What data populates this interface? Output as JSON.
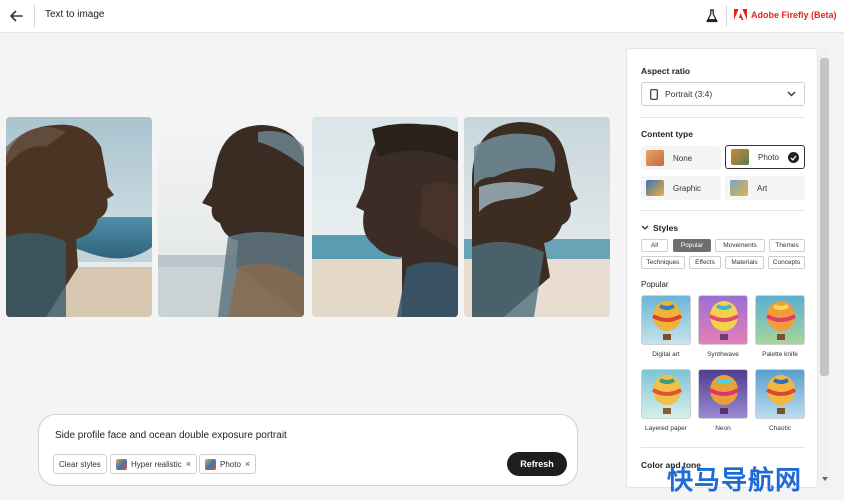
{
  "header": {
    "title": "Text to image",
    "brand": "Adobe Firefly (Beta)"
  },
  "gallery": {
    "images": [
      {
        "alt": "woman profile with ocean double exposure"
      },
      {
        "alt": "woman profile with beach double exposure"
      },
      {
        "alt": "man profile with ocean double exposure"
      },
      {
        "alt": "woman profile with clouds double exposure"
      }
    ]
  },
  "prompt": {
    "text": "Side profile face and ocean double exposure portrait",
    "clear_label": "Clear styles",
    "chips": [
      {
        "label": "Hyper realistic",
        "remove": "×"
      },
      {
        "label": "Photo",
        "remove": "×"
      }
    ],
    "refresh_label": "Refresh"
  },
  "panel": {
    "aspect_ratio": {
      "label": "Aspect ratio",
      "value": "Portrait (3:4)"
    },
    "content_type": {
      "label": "Content type",
      "options": [
        {
          "label": "None"
        },
        {
          "label": "Photo"
        },
        {
          "label": "Graphic"
        },
        {
          "label": "Art"
        }
      ],
      "selected": "Photo"
    },
    "styles": {
      "label": "Styles",
      "tabs_row1": [
        "All",
        "Popular",
        "Movements",
        "Themes"
      ],
      "tabs_row2": [
        "Techniques",
        "Effects",
        "Materials",
        "Concepts"
      ],
      "active_tab": "Popular",
      "group_label": "Popular",
      "tiles": [
        {
          "label": "Digital art"
        },
        {
          "label": "Synthwave"
        },
        {
          "label": "Palette knife"
        },
        {
          "label": "Layered paper"
        },
        {
          "label": "Neon"
        },
        {
          "label": "Chaotic"
        }
      ]
    },
    "color_tone": {
      "label": "Color and tone"
    }
  },
  "watermark": "快马导航网",
  "colors": {
    "brand_red": "#e1251b",
    "button_dark": "#1e1e1e",
    "active_tab": "#6e6e6e"
  }
}
